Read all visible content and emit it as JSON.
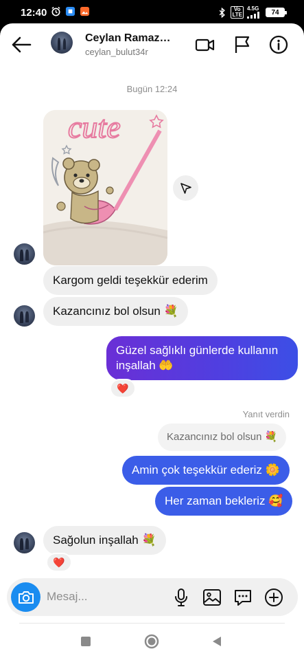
{
  "status_bar": {
    "time": "12:40",
    "net_top": "4.5G",
    "net_left": "Vo",
    "net_right": "LTE",
    "battery": "74"
  },
  "header": {
    "name": "Ceylan Ramaza...",
    "username": "ceylan_bulut34r"
  },
  "timestamp": "Bugün 12:24",
  "photo": {
    "embroidery_text": "cute"
  },
  "messages": [
    {
      "side": "in",
      "text": "Kargom geldi teşekkür ederim"
    },
    {
      "side": "in",
      "text": "Kazancınız bol olsun 💐"
    },
    {
      "side": "out",
      "text_line1": "Güzel sağlıklı günlerde kullanın",
      "text_line2": "inşallah 🤲",
      "reaction": "❤️"
    },
    {
      "side": "out",
      "replied_label": "Yanıt verdin",
      "replied_to": "Kazancınız bol olsun 💐",
      "text": "Amin çok teşekkür ederiz 🌼"
    },
    {
      "side": "out",
      "text": "Her zaman bekleriz 🥰"
    },
    {
      "side": "in",
      "text": "Sağolun inşallah 💐",
      "reaction": "❤️"
    }
  ],
  "composer": {
    "placeholder": "Mesaj..."
  },
  "colors": {
    "outgoing_gradient_start": "#6a2fd6",
    "outgoing_gradient_end": "#3c4fe6",
    "outgoing_solid": "#3b5de8",
    "incoming": "#efefef",
    "camera_button": "#1a8cf0"
  },
  "icons": {
    "back": "arrow-left-icon",
    "video": "video-camera-icon",
    "flag": "flag-icon",
    "info": "info-icon",
    "share": "send-icon",
    "camera": "camera-icon",
    "mic": "microphone-icon",
    "gallery": "image-icon",
    "sticker": "sticker-icon",
    "add": "plus-circle-icon"
  }
}
